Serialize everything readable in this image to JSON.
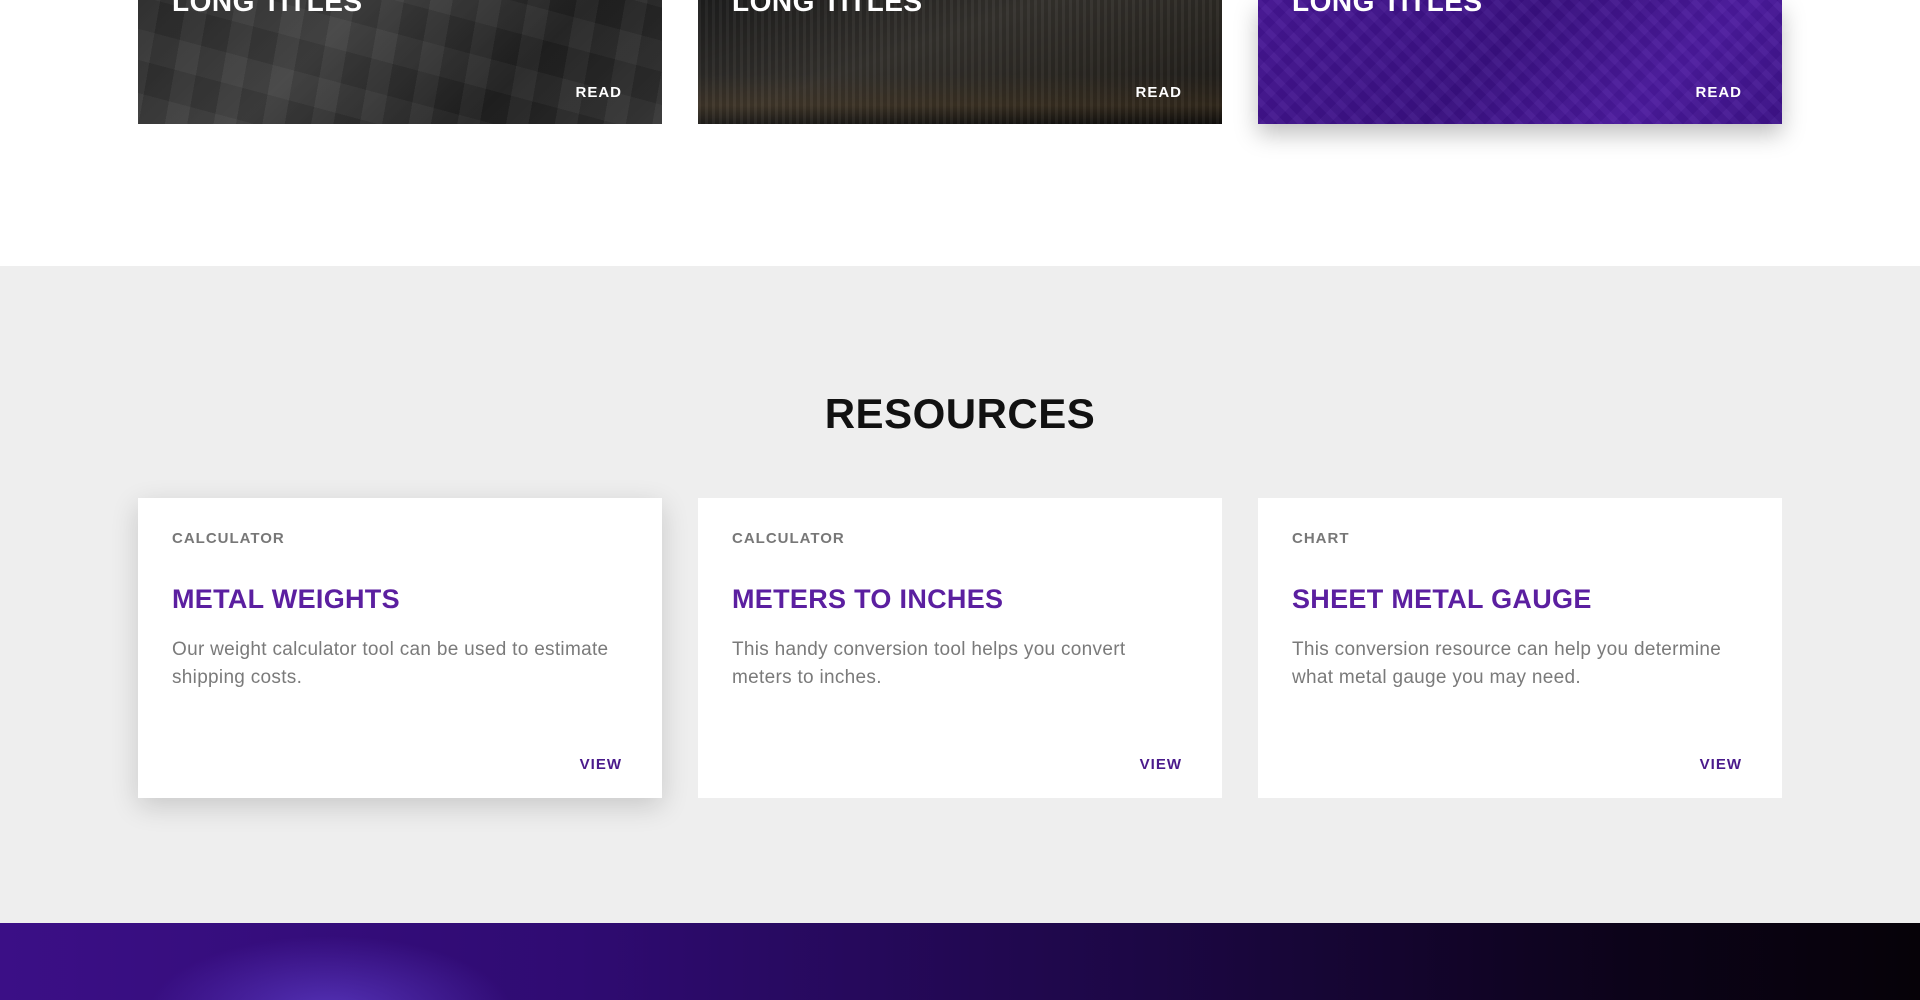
{
  "news_cards": [
    {
      "title": "LONG TITLES",
      "action": "READ"
    },
    {
      "title": "LONG TITLES",
      "action": "READ"
    },
    {
      "title": "LONG TITLES",
      "action": "READ"
    }
  ],
  "carousel": {
    "prev_icon": "chevron-left-icon",
    "next_icon": "chevron-right-icon"
  },
  "resources": {
    "heading": "RESOURCES",
    "cards": [
      {
        "category": "CALCULATOR",
        "title": "METAL WEIGHTS",
        "description": "Our weight calculator tool can be used to estimate shipping costs.",
        "action": "VIEW"
      },
      {
        "category": "CALCULATOR",
        "title": "METERS TO INCHES",
        "description": "This handy conversion tool helps you convert meters to inches.",
        "action": "VIEW"
      },
      {
        "category": "CHART",
        "title": "SHEET METAL GAUGE",
        "description": "This conversion resource can help you determine what metal gauge you may need.",
        "action": "VIEW"
      }
    ]
  },
  "colors": {
    "accent": "#5b1fa0",
    "section_bg": "#eeeeee",
    "footer_band": "#2f0b72"
  }
}
